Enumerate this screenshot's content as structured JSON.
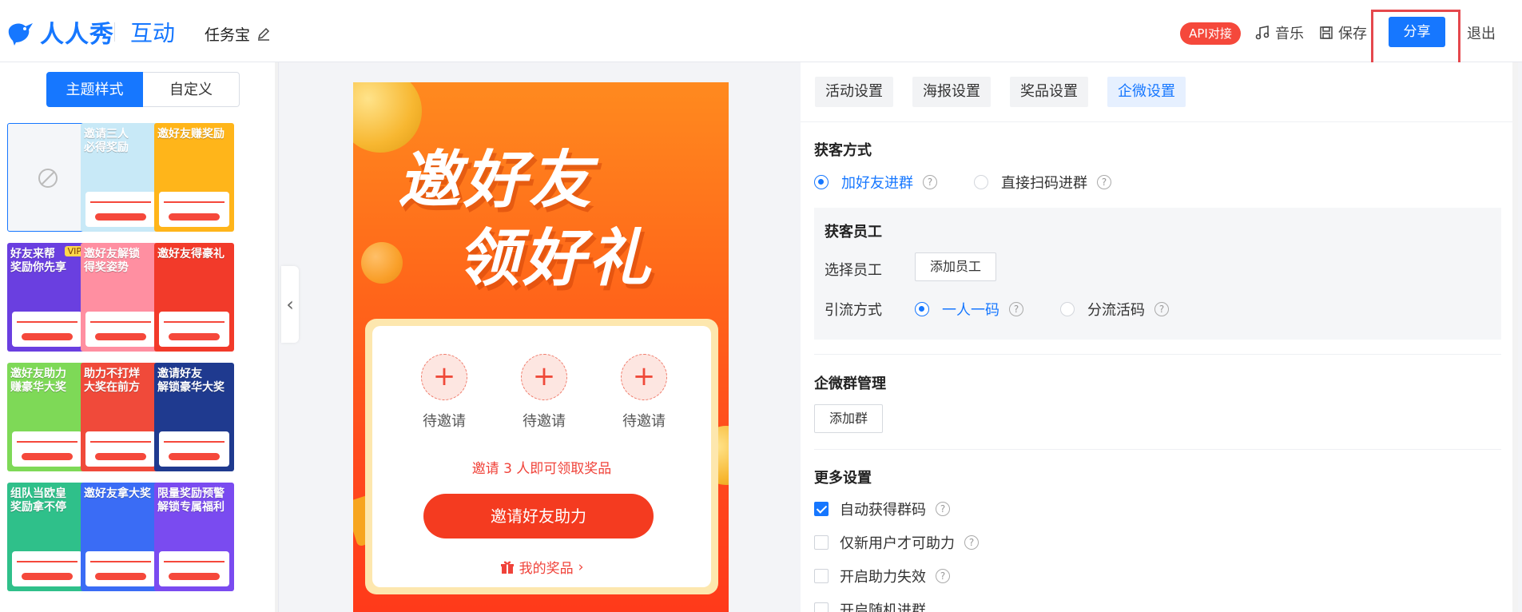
{
  "header": {
    "logo": "人人秀",
    "section": "互动",
    "title": "任务宝",
    "api_badge": "API对接",
    "music": "音乐",
    "save": "保存",
    "share": "分享",
    "exit": "退出"
  },
  "left": {
    "seg_theme": "主题样式",
    "seg_custom": "自定义",
    "templates": [
      {
        "title": "",
        "bg": "#f4f6f9"
      },
      {
        "title": "邀请三人\n必得奖励",
        "bg": "#c8e9f7"
      },
      {
        "title": "邀好友赚奖励",
        "bg": "#ffb51a"
      },
      {
        "title": "好友来帮\n奖励你先享",
        "bg": "#6a3fe0",
        "badge": "VIP"
      },
      {
        "title": "邀好友解锁\n得奖姿势",
        "bg": "#ff8fa1"
      },
      {
        "title": "邀好友得豪礼",
        "bg": "#f23a2a"
      },
      {
        "title": "邀好友助力\n赚豪华大奖",
        "bg": "#7ed957"
      },
      {
        "title": "助力不打烊\n大奖在前方",
        "bg": "#f04a3a"
      },
      {
        "title": "邀请好友\n解锁豪华大奖",
        "bg": "#1f3a8f"
      },
      {
        "title": "组队当欧皇\n奖励拿不停",
        "bg": "#2fc08a"
      },
      {
        "title": "邀好友拿大奖",
        "bg": "#3a6cf5"
      },
      {
        "title": "限量奖励预警\n解锁专属福利",
        "bg": "#7a4bf0"
      }
    ]
  },
  "preview": {
    "title_line1": "邀好友",
    "title_line2": "领好礼",
    "slot_label": "待邀请",
    "slot_plus": "+",
    "invite_note": "邀请 3 人即可领取奖品",
    "invite_button": "邀请好友助力",
    "my_prize": "我的奖品",
    "chevron": "›"
  },
  "settings": {
    "tabs": [
      "活动设置",
      "海报设置",
      "奖品设置",
      "企微设置"
    ],
    "active_tab": "企微设置",
    "acquire_title": "获客方式",
    "acquire_option1": "加好友进群",
    "acquire_option2": "直接扫码进群",
    "staff_title": "获客员工",
    "select_staff_label": "选择员工",
    "add_staff_button": "添加员工",
    "flow_label": "引流方式",
    "flow_option1": "一人一码",
    "flow_option2": "分流活码",
    "group_title": "企微群管理",
    "add_group_button": "添加群",
    "more_title": "更多设置",
    "more_options": [
      "自动获得群码",
      "仅新用户才可助力",
      "开启助力失效",
      "开启随机进群"
    ],
    "help": "?"
  }
}
